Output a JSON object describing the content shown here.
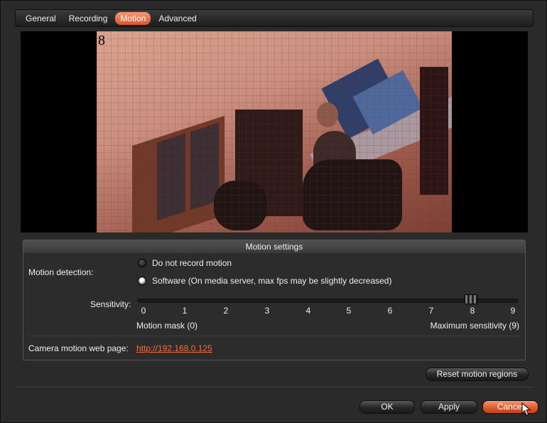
{
  "tabs": [
    {
      "label": "General"
    },
    {
      "label": "Recording"
    },
    {
      "label": "Motion",
      "active": true
    },
    {
      "label": "Advanced"
    }
  ],
  "video": {
    "frame_label": "8"
  },
  "motion_settings": {
    "title": "Motion settings",
    "detection_label": "Motion detection:",
    "options": [
      {
        "label": "Do not record motion",
        "checked": false
      },
      {
        "label": "Software (On media server, max fps may be slightly decreased)",
        "checked": true
      }
    ],
    "sensitivity_label": "Sensitivity:",
    "sensitivity_value": 8,
    "ticks": [
      "0",
      "1",
      "2",
      "3",
      "4",
      "5",
      "6",
      "7",
      "8",
      "9"
    ],
    "min_label": "Motion mask (0)",
    "max_label": "Maximum sensitivity (9)",
    "web_page_label": "Camera motion web page:",
    "web_page_url": "http://192.168.0.125"
  },
  "buttons": {
    "reset": "Reset motion regions",
    "ok": "OK",
    "apply": "Apply",
    "cancel": "Cancel"
  },
  "colors": {
    "accent": "#dd5a2a",
    "link": "#ff6a3a",
    "background": "#2a2a2a"
  }
}
